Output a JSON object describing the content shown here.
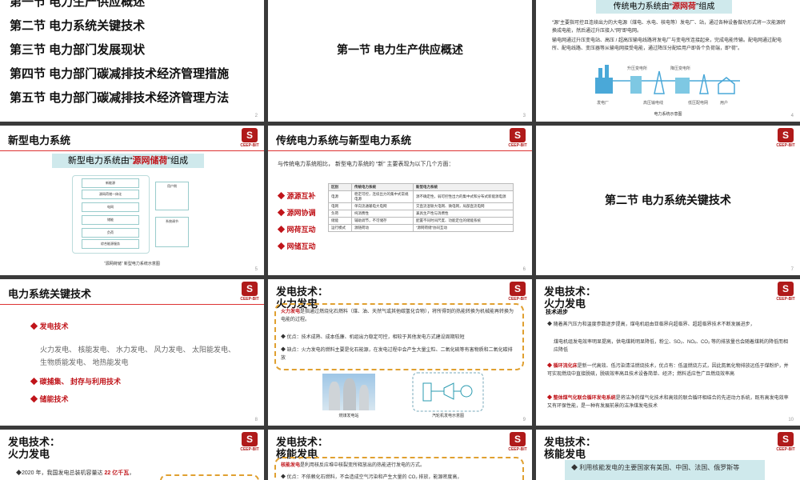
{
  "slide1": {
    "items": [
      "第一节 电力生产供应概述",
      "第二节 电力系统关键技术",
      "第三节 电力部门发展现状",
      "第四节 电力部门碳减排技术经济管理措施",
      "第五节 电力部门碳减排技术经济管理方法"
    ],
    "page": "2"
  },
  "slide2": {
    "title": "第一节 电力生产供应概述",
    "page": "3"
  },
  "slide3": {
    "banner_pre": "传统电力系统由“",
    "banner_hl": "源网荷",
    "banner_post": "”组成",
    "p1": "“源”主要指可控且连续出力的大电源（煤电、水电、核电等）发电厂、站，通过各种设备做功形式将一次能源转换成电能，然后通过升压接入“网”即电网。",
    "p2": "输电网通过升压变电站、高压 / 超高压输电线路将发电厂与变电所连接起来，完成电能传输。配电网通过配电所、配电线路、变压器等从输电网接受电能，通过降压分配给用户即各个负荷端，即“荷”。",
    "labels": [
      "发电厂",
      "升压变电所",
      "降压变电所",
      "高压输电线",
      "低压配电网",
      "用户"
    ],
    "caption": "电力系统示意图",
    "page": "4"
  },
  "slide4": {
    "header": "新型电力系统",
    "banner_pre": "新型电力系统由“",
    "banner_hl": "源网储荷",
    "banner_post": "”组成",
    "diagram_boxes": [
      "新能源",
      "源网荷储一体化",
      "电网",
      "储能",
      "负荷",
      "综合能源服务",
      "用户侧",
      "系统调节"
    ],
    "caption": "“源网荷储” 新型电力系统示意图",
    "logo_text": "CEEP-BIT",
    "page": "5"
  },
  "slide5": {
    "header": "传统电力系统与新型电力系统",
    "intro": "与传统电力系统相比， 新型电力系统的 “新” 主要表现为以下几个方面：",
    "bullets": [
      "源源互补",
      "源网协调",
      "网荷互动",
      "网储互动"
    ],
    "table_head": [
      "区别",
      "传统电力系统",
      "新型电力系统"
    ],
    "table_rows": [
      [
        "电源",
        "稳定可控，连续出力的集中式常规电源",
        "源不确定性，弱可控性出力的集中式和分布式新能源电源"
      ],
      [
        "电网",
        "单向流通输电大电网",
        "交直流混联大电网、微电网，局部直流电网"
      ],
      [
        "负荷",
        "纯消费性",
        "兼具生产性与消费性"
      ],
      [
        "储能",
        "辅助调节，不可储存",
        "配置不同时间尺度、功能定位的储能系统"
      ],
      [
        "运行模式",
        "源随荷动",
        "“源网荷储”协同互动"
      ]
    ],
    "logo_text": "CEEP-BIT",
    "page": "6"
  },
  "slide6": {
    "title": "第二节 电力系统关键技术",
    "logo_text": "CEEP-BIT",
    "page": "7"
  },
  "slide7": {
    "header": "电力系统关键技术",
    "b1": "发电技术",
    "b1_text1": "火力发电、 核能发电、 水力发电、 风力发电、 太阳能发电、",
    "b1_text2": "生物质能发电、 地热能发电",
    "b2": "碳捕集、 封存与利用技术",
    "b3": "储能技术",
    "logo_text": "CEEP-BIT",
    "page": "8"
  },
  "slide8": {
    "header": "发电技术： 火力发电",
    "p1_hl": "火力发电",
    "p1": "是指通过燃烧化石燃料（煤、油、天然气或其他碳氢化合物），将所得到的热能转换为机械能再转换为电能的过程。",
    "p2": "◆ 优点：技术成熟、成本低廉、机组出力稳定可控，相较于其他发电方式建设周期较短",
    "p3": "◆ 缺点：火力发电的燃料主要是化石能源，在发电过程中会产生大量尘粒、二氧化硫等有害物质和二氧化碳排放",
    "cap1": "燃煤发电站",
    "cap2": "汽轮机发电示意图",
    "logo_text": "CEEP-BIT",
    "page": "9"
  },
  "slide9": {
    "header": "发电技术： 火力发电",
    "sub": "技术进步",
    "p1": "◆ 随着蒸汽压力和温度参数逐步提高，煤电机组由亚临界向超临界、超超临界技术不断发展进步，",
    "p2": "煤电机组发电效率明显提高，供电煤耗明显降低，粉尘、SO₂、NOₓ、CO₂ 等的排放量也会随着煤耗的降低而相应降低",
    "p3_hl": "◆ 循环流化床",
    "p3": "是新一代高效、低污染清洁燃烧技术，优点有：低温燃烧方式，因此氮氧化物排放远低于煤粉炉，并可实现燃烧中直接脱硫，脱硫效率高且技术设备简单、经济；燃料适应性广且燃烧效率高",
    "p4_hl": "◆ 整体煤气化联合循环发电系统",
    "p4": "是将洁净的煤气化技术和高效的联合循环相结合的先进动力系统，既有高发电效率又有环保性能，是一种有发展前景的洁净煤发电技术",
    "logo_text": "CEEP-BIT",
    "page": "10"
  },
  "slide10": {
    "header": "发电技术： 火力发电",
    "p1_pre": "◆2020 年，我国发电总装机容量达 ",
    "p1_hl": "22 亿千瓦",
    "p1_post": "，",
    "logo_text": "CEEP-BIT"
  },
  "slide11": {
    "header": "发电技术： 核能发电",
    "p1_hl": "核能发电",
    "p1": "是利用核反应堆中核裂变所释放出的热能进行发电的方式。",
    "p2": "◆ 优点：不依赖化石燃料，不会造成空气污染和产生大量的 CO₂ 排放，能源密度高，",
    "logo_text": "CEEP-BIT"
  },
  "slide12": {
    "header": "发电技术： 核能发电",
    "p1": "◆ 利用核能发电的主要国家有美国、中国、法国、俄罗斯等",
    "logo_text": "CEEP-BIT"
  }
}
